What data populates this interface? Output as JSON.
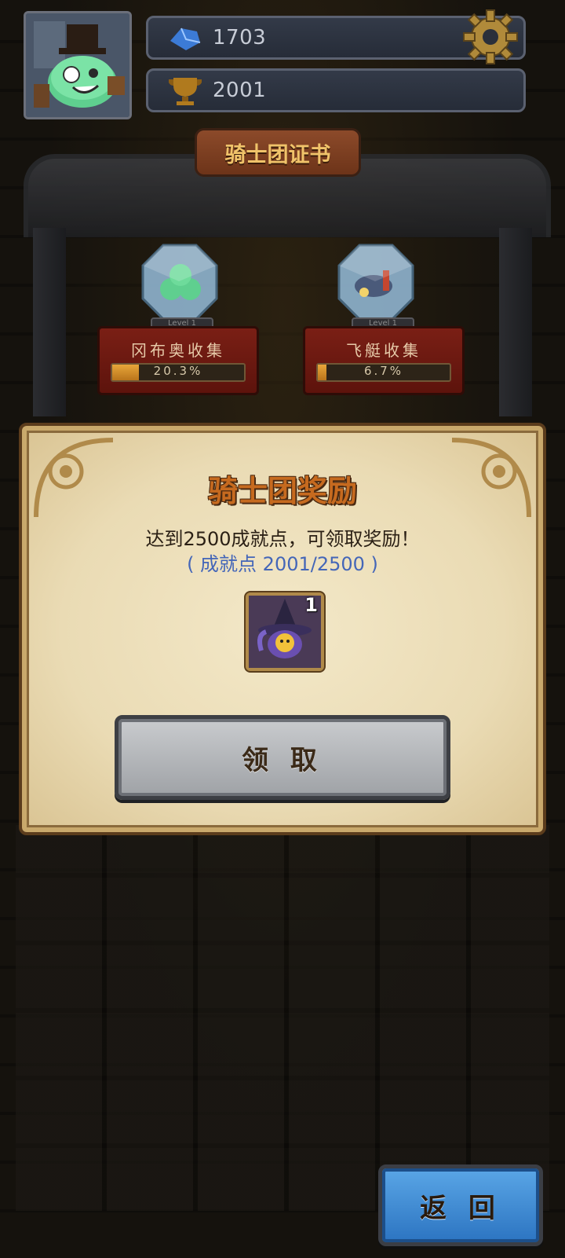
{
  "hud": {
    "gems": "1703",
    "trophies": "2001"
  },
  "certificate": {
    "title": "骑士团证书",
    "collections": [
      {
        "name": "冈布奥收集",
        "level": "Level 1",
        "percent_text": "20.3%",
        "fill": 0.203
      },
      {
        "name": "飞艇收集",
        "level": "Level 1",
        "percent_text": "6.7%",
        "fill": 0.067
      }
    ]
  },
  "modal": {
    "title": "骑士团奖励",
    "message": "达到2500成就点，可领取奖励！",
    "progress": "( 成就点 2001/2500 )",
    "reward_qty": "1",
    "claim_label": "领 取"
  },
  "back_label": "返 回",
  "colors": {
    "modal_title": "#c66a1f",
    "progress_text": "#4466b8",
    "back_button": "#3a86d4"
  }
}
